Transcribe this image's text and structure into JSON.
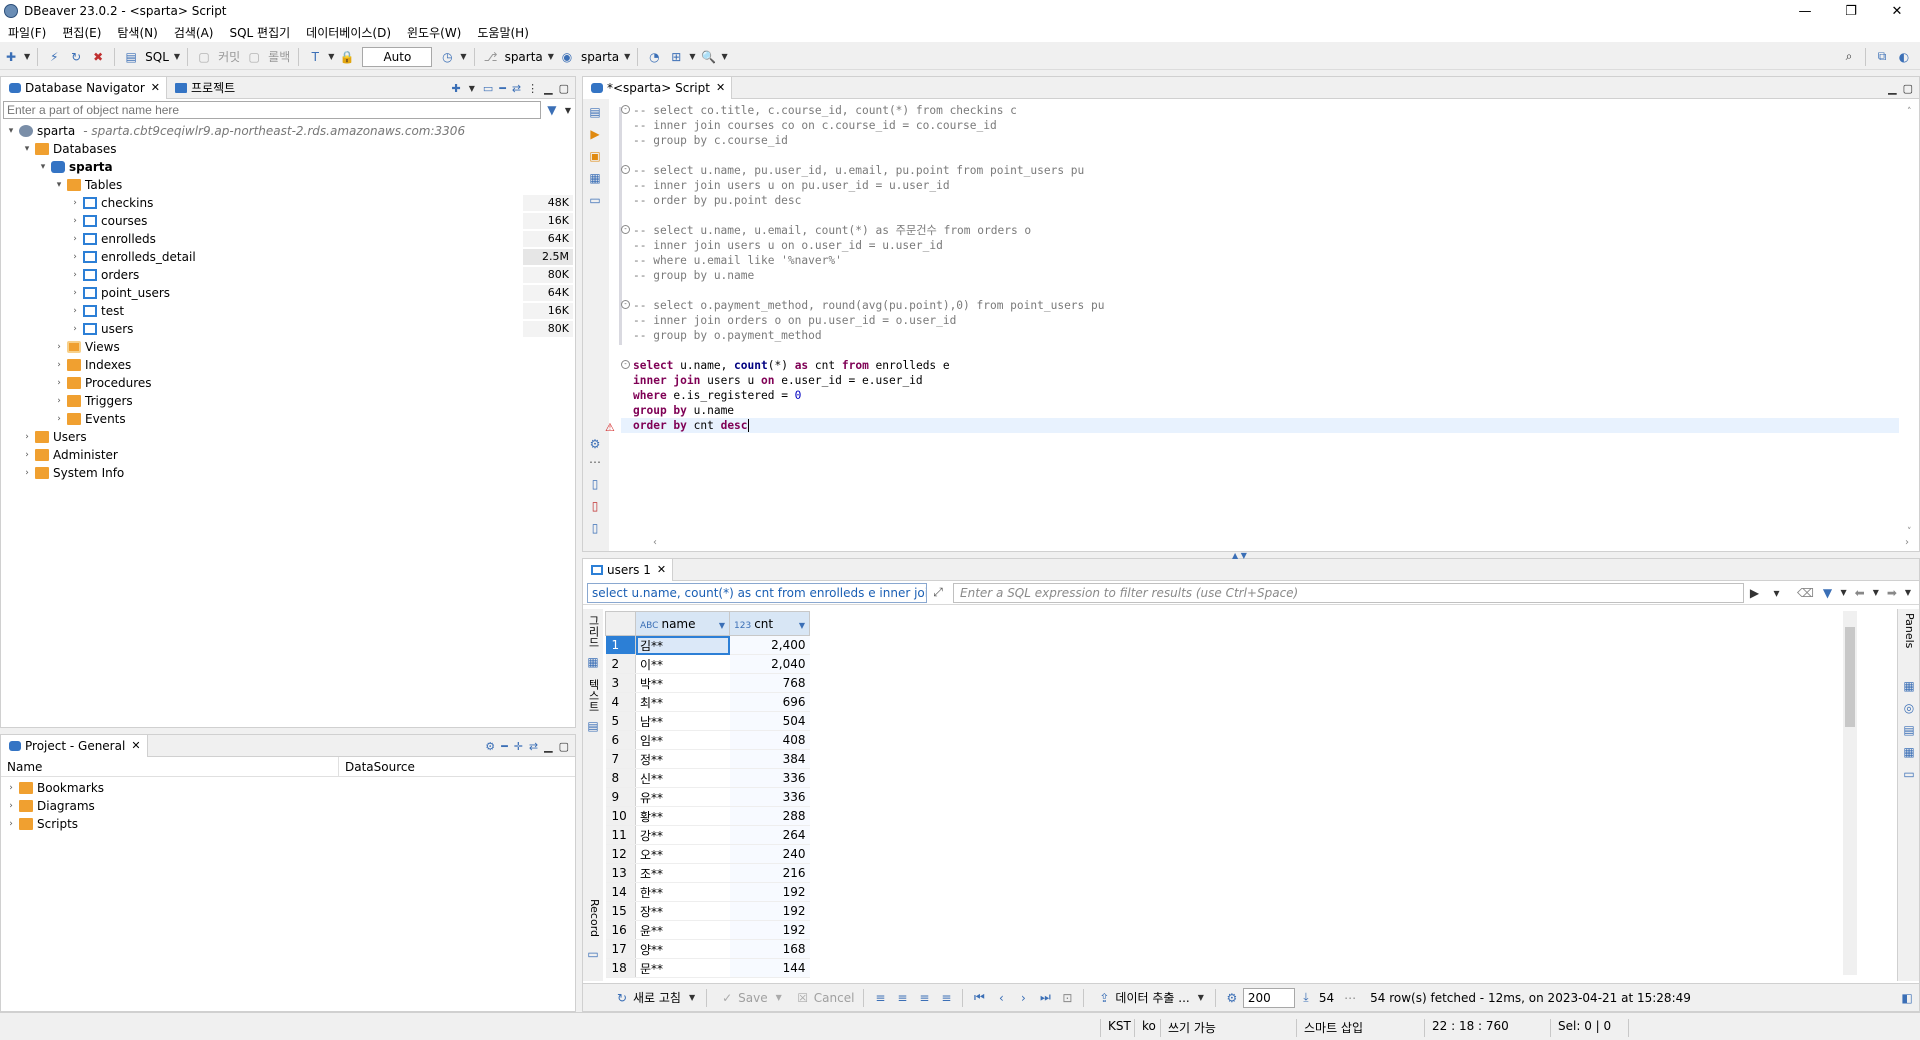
{
  "window": {
    "title": "DBeaver 23.0.2 - <sparta> Script",
    "minimize": "—",
    "maximize": "❐",
    "close": "✕"
  },
  "menu": [
    "파일(F)",
    "편집(E)",
    "탐색(N)",
    "검색(A)",
    "SQL 편집기",
    "데이터베이스(D)",
    "윈도우(W)",
    "도움말(H)"
  ],
  "toolbar": {
    "sql_label": "SQL",
    "commit_label": "커밋",
    "rollback_label": "롤백",
    "auto_label": "Auto",
    "datasource_label": "sparta",
    "schema_label": "sparta"
  },
  "navigator": {
    "tab_label": "Database Navigator",
    "tab2_label": "프로젝트",
    "filter_placeholder": "Enter a part of object name here",
    "connection": {
      "name": "sparta",
      "host": "- sparta.cbt9ceqiwlr9.ap-northeast-2.rds.amazonaws.com:3306"
    },
    "databases_label": "Databases",
    "schema_label": "sparta",
    "tables_label": "Tables",
    "tables": [
      {
        "name": "checkins",
        "size": "48K"
      },
      {
        "name": "courses",
        "size": "16K"
      },
      {
        "name": "enrolleds",
        "size": "64K"
      },
      {
        "name": "enrolleds_detail",
        "size": "2.5M"
      },
      {
        "name": "orders",
        "size": "80K"
      },
      {
        "name": "point_users",
        "size": "64K"
      },
      {
        "name": "test",
        "size": "16K"
      },
      {
        "name": "users",
        "size": "80K"
      }
    ],
    "schema_children": [
      "Views",
      "Indexes",
      "Procedures",
      "Triggers",
      "Events"
    ],
    "root_children": [
      "Users",
      "Administer",
      "System Info"
    ]
  },
  "project": {
    "tab_label": "Project - General",
    "col_name": "Name",
    "col_datasource": "DataSource",
    "items": [
      "Bookmarks",
      "Diagrams",
      "Scripts"
    ]
  },
  "editor": {
    "tab_label": "*<sparta> Script",
    "lines": [
      "-- select co.title, c.course_id, count(*) from checkins c",
      "-- inner join courses co on c.course_id = co.course_id",
      "-- group by c.course_id",
      "",
      "-- select u.name, pu.user_id, u.email, pu.point from point_users pu",
      "-- inner join users u on pu.user_id = u.user_id",
      "-- order by pu.point desc",
      "",
      "-- select u.name, u.email, count(*) as 주문건수 from orders o",
      "-- inner join users u on o.user_id = u.user_id",
      "-- where u.email like '%naver%'",
      "-- group by u.name",
      "",
      "-- select o.payment_method, round(avg(pu.point),0) from point_users pu",
      "-- inner join orders o on pu.user_id = o.user_id",
      "-- group by o.payment_method",
      ""
    ],
    "query": {
      "l1": [
        "select",
        " u.name, ",
        "count",
        "(*) ",
        "as",
        " cnt ",
        "from",
        " enrolleds e"
      ],
      "l2": [
        "inner join",
        " users u ",
        "on",
        " e.user_id = e.user_id"
      ],
      "l3": [
        "where",
        " e.is_registered = ",
        "0"
      ],
      "l4": [
        "group by",
        " u.name"
      ],
      "l5": [
        "order by",
        " cnt ",
        "desc"
      ]
    }
  },
  "results": {
    "tab_label": "users 1",
    "query_text": "select u.name, count(*) as cnt from enrolleds e inner join",
    "filter_placeholder": "Enter a SQL expression to filter results (use Ctrl+Space)",
    "side_tab_grid": "그리드",
    "side_tab_text": "텍스트",
    "side_tab_record": "Record",
    "columns": [
      {
        "type": "ABC",
        "name": "name"
      },
      {
        "type": "123",
        "name": "cnt"
      }
    ],
    "rows": [
      [
        "1",
        "김**",
        "2,400"
      ],
      [
        "2",
        "이**",
        "2,040"
      ],
      [
        "3",
        "박**",
        "768"
      ],
      [
        "4",
        "최**",
        "696"
      ],
      [
        "5",
        "남**",
        "504"
      ],
      [
        "6",
        "임**",
        "408"
      ],
      [
        "7",
        "정**",
        "384"
      ],
      [
        "8",
        "신**",
        "336"
      ],
      [
        "9",
        "유**",
        "336"
      ],
      [
        "10",
        "황**",
        "288"
      ],
      [
        "11",
        "강**",
        "264"
      ],
      [
        "12",
        "오**",
        "240"
      ],
      [
        "13",
        "조**",
        "216"
      ],
      [
        "14",
        "한**",
        "192"
      ],
      [
        "15",
        "장**",
        "192"
      ],
      [
        "16",
        "윤**",
        "192"
      ],
      [
        "17",
        "양**",
        "168"
      ],
      [
        "18",
        "문**",
        "144"
      ]
    ],
    "bottom": {
      "refresh_label": "새로 고침",
      "save_label": "Save",
      "cancel_label": "Cancel",
      "export_label": "데이터 추출 ...",
      "limit": "200",
      "count": "54",
      "fetch_status": "54 row(s) fetched - 12ms, on 2023-04-21 at 15:28:49"
    },
    "panels_label": "Panels"
  },
  "status": {
    "tz": "KST",
    "lang": "ko",
    "mode": "쓰기 가능",
    "insert": "스마트 삽입",
    "pos": "22 : 18 : 760",
    "sel": "Sel: 0 | 0"
  }
}
